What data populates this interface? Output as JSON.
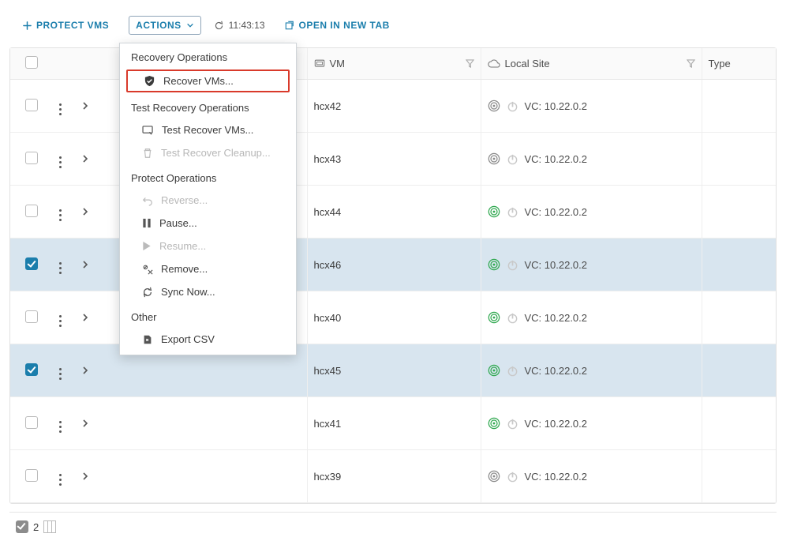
{
  "toolbar": {
    "protect": "PROTECT VMS",
    "actions": "ACTIONS",
    "time": "11:43:13",
    "open_new_tab": "OPEN IN NEW TAB"
  },
  "columns": {
    "vm": "VM",
    "local_site": "Local Site",
    "type": "Type"
  },
  "rows": [
    {
      "vm": "hcx42",
      "site": "VC: 10.22.0.2",
      "selected": false,
      "status": "grey"
    },
    {
      "vm": "hcx43",
      "site": "VC: 10.22.0.2",
      "selected": false,
      "status": "grey"
    },
    {
      "vm": "hcx44",
      "site": "VC: 10.22.0.2",
      "selected": false,
      "status": "green"
    },
    {
      "vm": "hcx46",
      "site": "VC: 10.22.0.2",
      "selected": true,
      "status": "green"
    },
    {
      "vm": "hcx40",
      "site": "VC: 10.22.0.2",
      "selected": false,
      "status": "green"
    },
    {
      "vm": "hcx45",
      "site": "VC: 10.22.0.2",
      "selected": true,
      "status": "green"
    },
    {
      "vm": "hcx41",
      "site": "VC: 10.22.0.2",
      "selected": false,
      "status": "green"
    },
    {
      "vm": "hcx39",
      "site": "VC: 10.22.0.2",
      "selected": false,
      "status": "grey"
    }
  ],
  "menu": {
    "recovery_title": "Recovery Operations",
    "recover": "Recover VMs...",
    "test_title": "Test Recovery Operations",
    "test_recover": "Test Recover VMs...",
    "test_cleanup": "Test Recover Cleanup...",
    "protect_title": "Protect Operations",
    "reverse": "Reverse...",
    "pause": "Pause...",
    "resume": "Resume...",
    "remove": "Remove...",
    "sync": "Sync Now...",
    "other_title": "Other",
    "export": "Export CSV"
  },
  "footer": {
    "count": "2"
  },
  "colors": {
    "green": "#2fa84f",
    "grey": "#8a8a8a",
    "accent": "#1b7eac",
    "highlight": "#d93a2b"
  }
}
